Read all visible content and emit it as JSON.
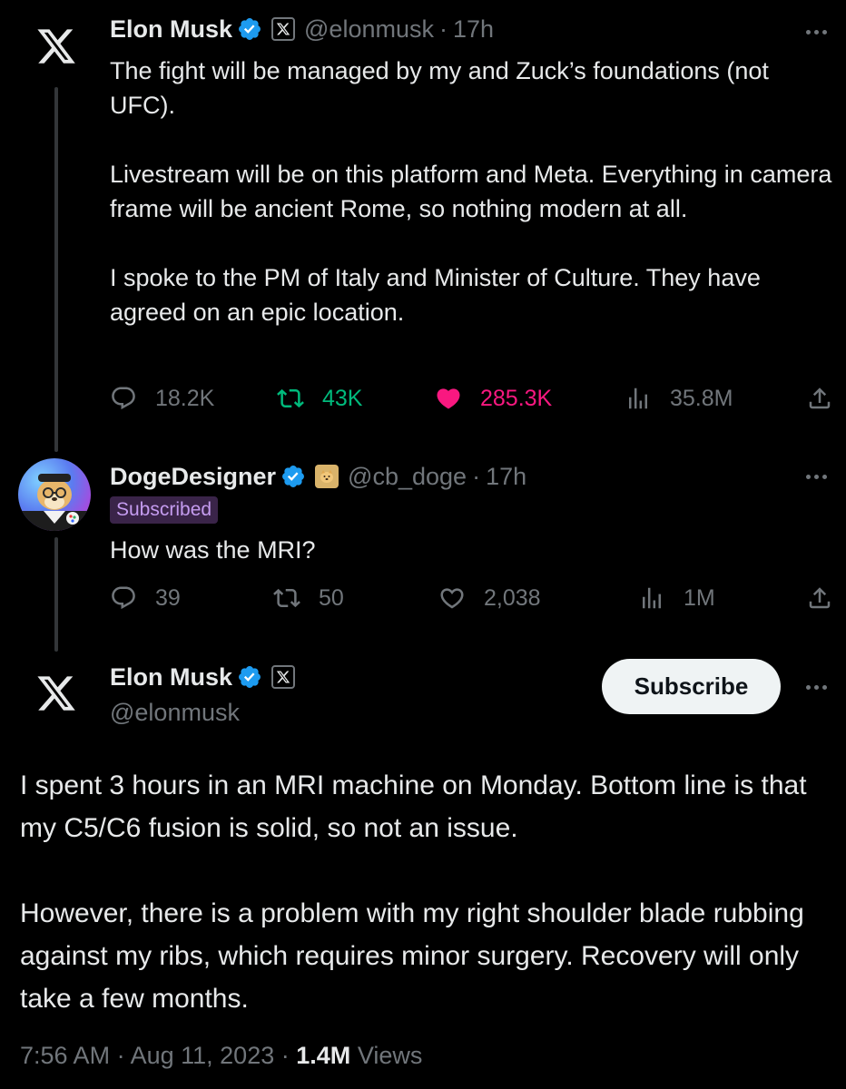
{
  "tweets": [
    {
      "name": "Elon Musk",
      "handle": "@elonmusk",
      "time": "17h",
      "text": "The fight will be managed by my and Zuck’s foundations (not UFC).\n\nLivestream will be on this platform and Meta. Everything in camera frame will be ancient Rome, so nothing modern at all.\n\nI spoke to the PM of Italy and Minister of Culture. They have agreed on an epic location.",
      "replies": "18.2K",
      "reposts": "43K",
      "likes": "285.3K",
      "views": "35.8M",
      "liked": true,
      "reposted": true,
      "affiliate_icon": "x-logo-icon"
    },
    {
      "name": "DogeDesigner",
      "handle": "@cb_doge",
      "time": "17h",
      "badge": "Subscribed",
      "text": "How was the MRI?",
      "replies": "39",
      "reposts": "50",
      "likes": "2,038",
      "views": "1M",
      "affiliate_icon": "doge-icon"
    }
  ],
  "main_tweet": {
    "name": "Elon Musk",
    "handle": "@elonmusk",
    "subscribe_label": "Subscribe",
    "text": "I spent 3 hours in an MRI machine on Monday. Bottom line is that my C5/C6 fusion is solid, so not an issue.\n\nHowever, there is a problem with my right shoulder blade rubbing against my ribs, which requires minor surgery. Recovery will only take a few months.",
    "time": "7:56 AM",
    "date": "Aug 11, 2023",
    "views_count": "1.4M",
    "views_label": "Views"
  },
  "separator": "·",
  "colors": {
    "background": "#000000",
    "text": "#e7e9ea",
    "muted": "#71767b",
    "verified": "#1d9bf0",
    "repost_green": "#00ba7c",
    "like_pink": "#f91880",
    "subscribed_bg": "#3a2449",
    "subscribed_text": "#c59cf0"
  }
}
